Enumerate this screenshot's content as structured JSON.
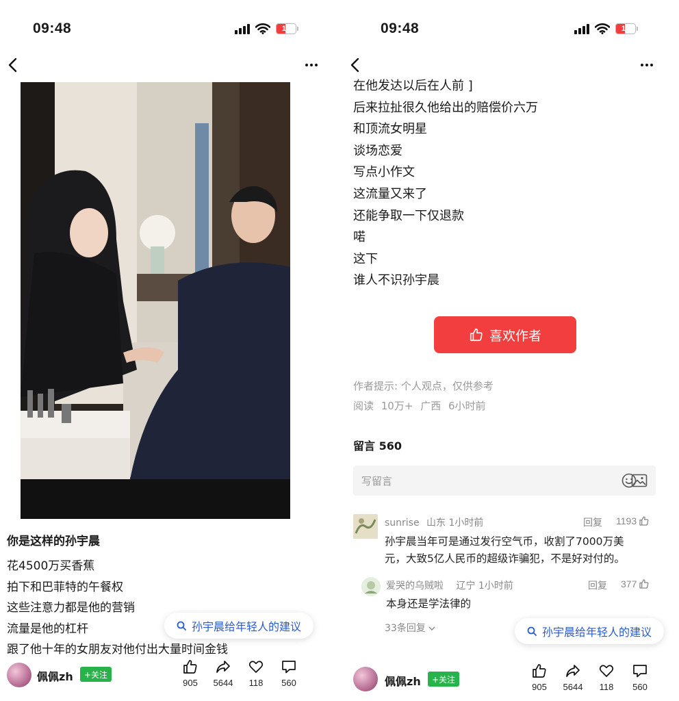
{
  "left": {
    "status": {
      "time": "09:48",
      "battery": "13"
    },
    "post_title": "你是这样的孙宇晨",
    "post_lines": [
      "花4500万买香蕉",
      "拍下和巴菲特的午餐权",
      "这些注意力都是他的营销",
      "流量是他的杠杆",
      "跟了他十年的女朋友对他付出大量时间金钱"
    ],
    "search_suggestion": "孙宇晨给年轻人的建议",
    "author": {
      "name": "佩佩zh",
      "follow": "+关注"
    },
    "stats": {
      "likes": "905",
      "shares": "5644",
      "favorites": "118",
      "comments": "560"
    }
  },
  "right": {
    "status": {
      "time": "09:48",
      "battery": "13"
    },
    "article_lines": [
      "在他发达以后在人前 ]",
      "后来拉扯很久他给出的赔偿价六万",
      "和顶流女明星",
      "谈场恋爱",
      "写点小作文",
      "这流量又来了",
      "还能争取一下仅退款",
      "喏",
      "这下",
      "谁人不识孙宇晨"
    ],
    "like_author_button": "喜欢作者",
    "author_hint": "作者提示: 个人观点，仅供参考",
    "meta": "阅读 10万+ 广西 6小时前",
    "comments_title": "留言 560",
    "comment_placeholder": "写留言",
    "comments": [
      {
        "user": "sunrise",
        "location_time": "山东 1小时前",
        "reply": "回复",
        "likes": "1193",
        "text_lines": [
          "孙宇晨当年可是通过发行空气币，收割了7000万美",
          "元，大致5亿人民币的超级诈骗犯，不是好对付的。"
        ]
      },
      {
        "user": "爱哭的乌贼啦",
        "location_time": "辽宁 1小时前",
        "reply": "回复",
        "likes": "377",
        "text_lines": [
          "本身还是学法律的"
        ],
        "more_replies": "33条回复"
      }
    ],
    "search_suggestion": "孙宇晨给年轻人的建议",
    "author": {
      "name": "佩佩zh",
      "follow": "+关注"
    },
    "stats": {
      "likes": "905",
      "shares": "5644",
      "favorites": "118",
      "comments": "560"
    }
  }
}
